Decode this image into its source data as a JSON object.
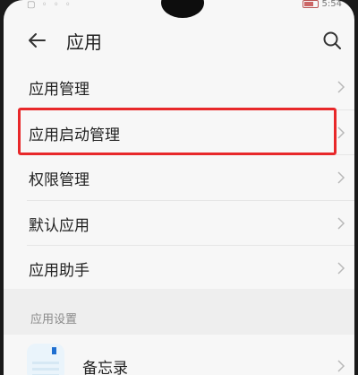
{
  "status_bar": {
    "left_icons": "▢ ◦ ◦ ◦",
    "time": "5:54"
  },
  "header": {
    "title": "应用",
    "back_icon": "arrow-left-icon",
    "search_icon": "search-icon"
  },
  "menu": {
    "items": [
      {
        "label": "应用管理"
      },
      {
        "label": "应用启动管理"
      },
      {
        "label": "权限管理"
      },
      {
        "label": "默认应用"
      },
      {
        "label": "应用助手"
      }
    ],
    "highlighted_index": 1,
    "highlight_color": "#e8282a"
  },
  "section": {
    "header": "应用设置"
  },
  "apps": [
    {
      "label": "备忘录",
      "icon": "memo-app-icon"
    }
  ]
}
